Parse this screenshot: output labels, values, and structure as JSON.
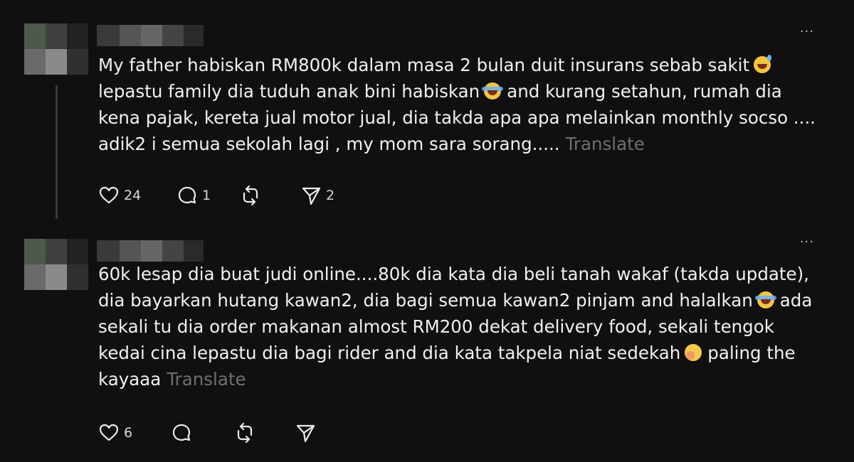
{
  "posts": [
    {
      "more_label": "···",
      "text_parts": [
        "My father habiskan RM800k dalam masa 2 bulan duit insurans sebab sakit",
        "lepastu family dia tuduh anak bini habiskan",
        "and kurang setahun, rumah dia kena pajak, kereta jual motor jual, dia takda apa apa melainkan monthly socso .... adik2 i semua sekolah lagi , my mom sara sorang....."
      ],
      "translate_label": "Translate",
      "emojis": [
        "grinning-sweat-emoji",
        "tears-of-joy-emoji"
      ],
      "actions": {
        "likes": "24",
        "comments": "1",
        "shares": "2"
      }
    },
    {
      "more_label": "···",
      "text_parts": [
        "60k lesap dia buat judi online....80k dia kata dia beli tanah wakaf (takda update), dia bayarkan hutang kawan2, dia bagi semua kawan2 pinjam and halalkan",
        "ada sekali tu dia order makanan almost RM200 dekat delivery food, sekali tengok kedai cina lepastu dia bagi rider and dia kata takpela niat sedekah",
        "paling the kayaaa"
      ],
      "translate_label": "Translate",
      "emojis": [
        "tears-of-joy-emoji",
        "hand-over-mouth-emoji"
      ],
      "actions": {
        "likes": "6"
      }
    }
  ]
}
